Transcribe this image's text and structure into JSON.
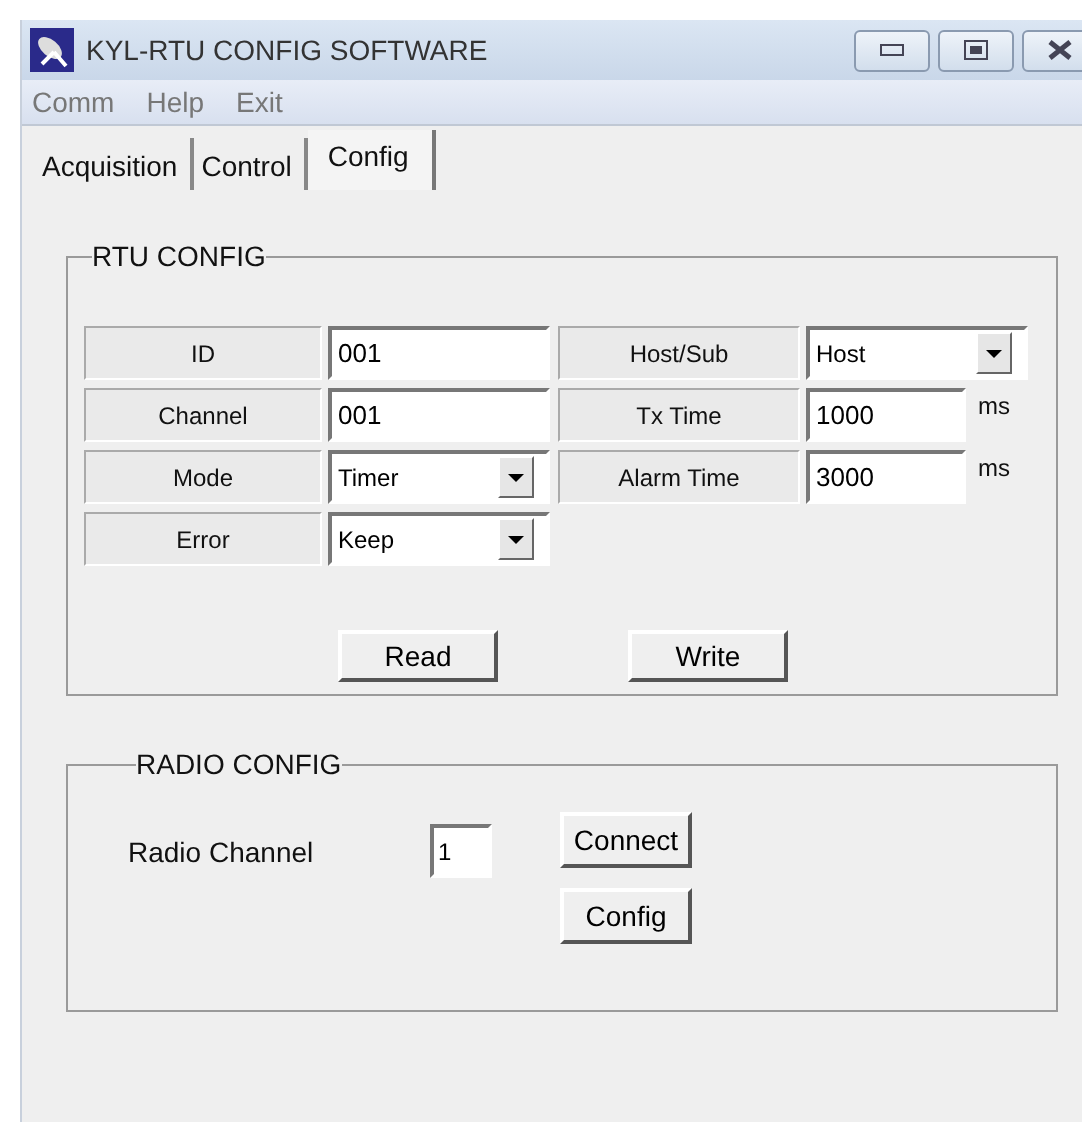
{
  "window": {
    "title": "KYL-RTU CONFIG SOFTWARE"
  },
  "menu": [
    "Comm",
    "Help",
    "Exit"
  ],
  "tabs": [
    {
      "label": "Acquisition",
      "selected": false
    },
    {
      "label": "Control",
      "selected": false
    },
    {
      "label": "Config",
      "selected": true
    }
  ],
  "rtu_config": {
    "title": "RTU CONFIG",
    "left_fields": [
      {
        "label": "ID",
        "kind": "text",
        "value": "001"
      },
      {
        "label": "Channel",
        "kind": "text",
        "value": "001"
      },
      {
        "label": "Mode",
        "kind": "select",
        "value": "Timer"
      },
      {
        "label": "Error",
        "kind": "select",
        "value": "Keep"
      }
    ],
    "right_fields": [
      {
        "label": "Host/Sub",
        "kind": "select",
        "value": "Host"
      },
      {
        "label": "Tx Time",
        "kind": "text",
        "value": "1000",
        "unit": "ms"
      },
      {
        "label": "Alarm Time",
        "kind": "text",
        "value": "3000",
        "unit": "ms"
      }
    ],
    "buttons": [
      "Read",
      "Write"
    ]
  },
  "radio_config": {
    "title": "RADIO CONFIG",
    "label": "Radio Channel",
    "value": "1",
    "buttons": [
      "Connect",
      "Config"
    ]
  }
}
